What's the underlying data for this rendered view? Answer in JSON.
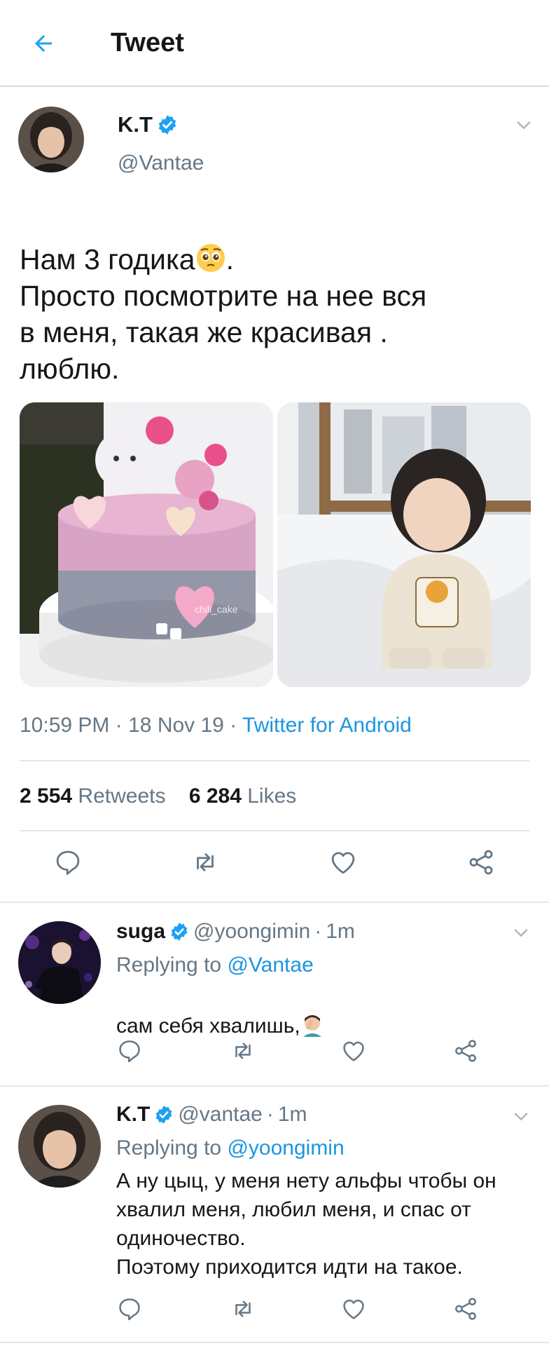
{
  "header": {
    "title": "Tweet"
  },
  "main_tweet": {
    "name": "K.T",
    "handle": "@Vantae",
    "text_line1": "Нам 3 годика",
    "text_line1_end": ".",
    "text_rest": "Просто посмотрите на нее вся\nв меня, такая же красивая .\nлюблю.",
    "cake_watermark": "chili_cake",
    "time": "10:59 PM",
    "date": "18 Nov 19",
    "source": "Twitter for Android",
    "retweets_count": "2 554",
    "retweets_label": "Retweets",
    "likes_count": "6 284",
    "likes_label": "Likes"
  },
  "replies": [
    {
      "name": "suga",
      "handle": "@yoongimin",
      "time": "1m",
      "replying_prefix": "Replying to",
      "replying_to": "@Vantae",
      "text": "сам себя хвалишь,"
    },
    {
      "name": "K.T",
      "handle": "@vantae",
      "time": "1m",
      "replying_prefix": "Replying to",
      "replying_to": "@yoongimin",
      "text": "А ну цыц, у меня нету альфы чтобы он\nхвалил меня, любил меня, и спас от\nодиночество.\nПоэтому приходится идти на такое."
    }
  ],
  "colors": {
    "accent": "#1da1f2",
    "link": "#1b95e0",
    "secondary": "#657786",
    "icon": "#657786"
  },
  "separator": "·"
}
